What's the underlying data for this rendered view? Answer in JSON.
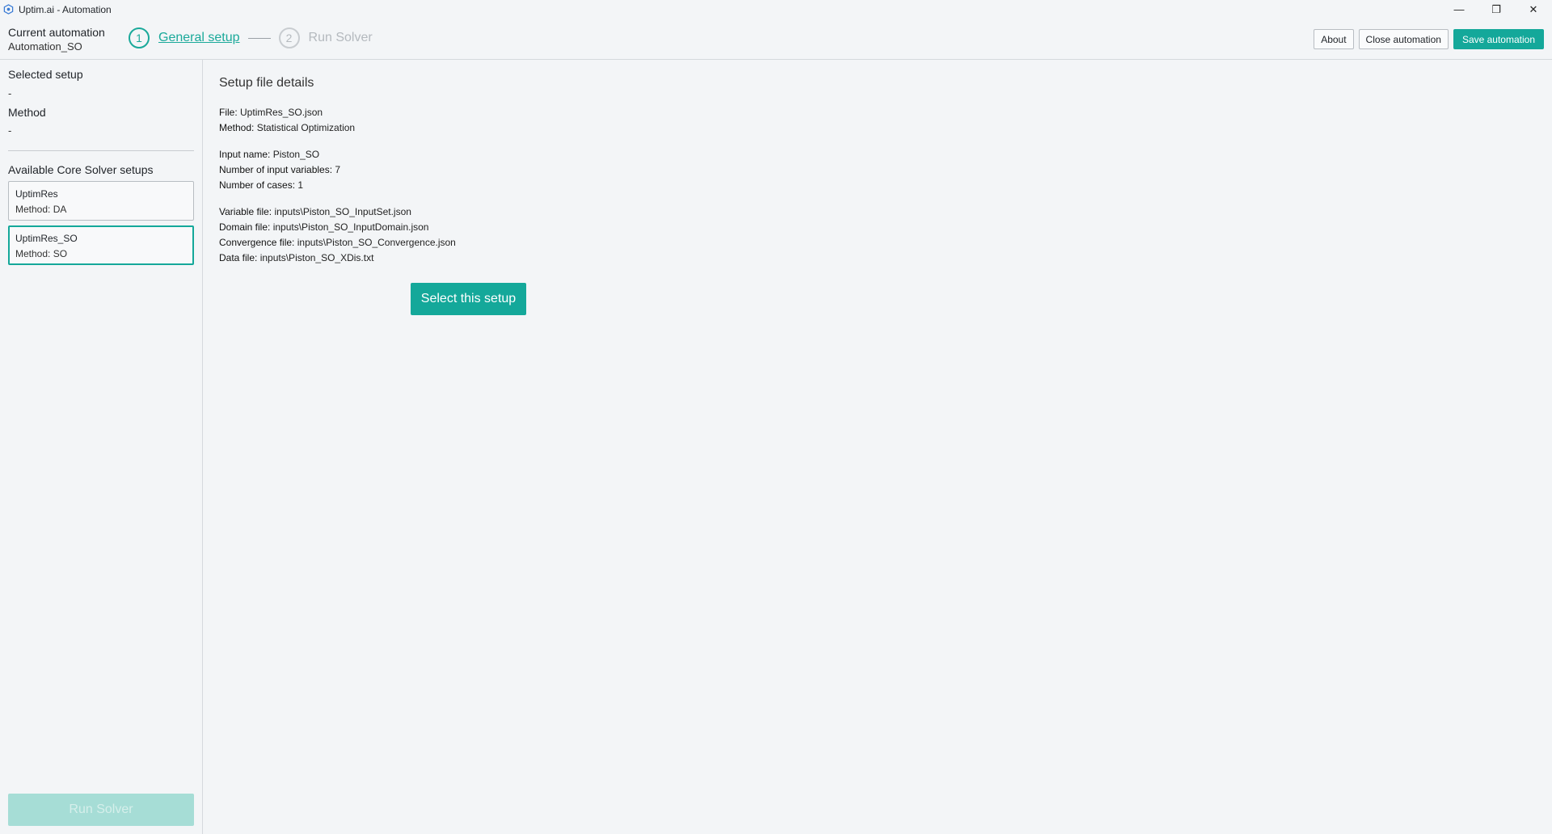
{
  "window": {
    "title": "Uptim.ai - Automation",
    "controls": {
      "minimize": "—",
      "restore": "❐",
      "close": "✕"
    }
  },
  "header": {
    "current_automation_label": "Current automation",
    "current_automation_value": "Automation_SO",
    "steps": [
      {
        "number": "1",
        "label": "General setup",
        "state": "active"
      },
      {
        "number": "2",
        "label": "Run Solver",
        "state": "inactive"
      }
    ],
    "buttons": {
      "about": "About",
      "close": "Close automation",
      "save": "Save automation"
    }
  },
  "sidebar": {
    "selected_setup_label": "Selected setup",
    "selected_setup_value": "-",
    "method_label": "Method",
    "method_value": "-",
    "available_label": "Available Core Solver setups",
    "setups": [
      {
        "name": "UptimRes",
        "method": "Method: DA",
        "selected": false
      },
      {
        "name": "UptimRes_SO",
        "method": "Method: SO",
        "selected": true
      }
    ],
    "run_button": "Run Solver"
  },
  "main": {
    "title": "Setup file details",
    "group1": [
      {
        "key": "File:",
        "value": "UptimRes_SO.json"
      },
      {
        "key": "Method:",
        "value": "Statistical Optimization"
      }
    ],
    "group2": [
      {
        "key": "Input name:",
        "value": "Piston_SO"
      },
      {
        "key": "Number of input variables:",
        "value": "7"
      },
      {
        "key": "Number of cases:",
        "value": "1"
      }
    ],
    "group3": [
      {
        "key": "Variable file:",
        "value": "inputs\\Piston_SO_InputSet.json"
      },
      {
        "key": "Domain file:",
        "value": "inputs\\Piston_SO_InputDomain.json"
      },
      {
        "key": "Convergence file:",
        "value": "inputs\\Piston_SO_Convergence.json"
      },
      {
        "key": "Data file:",
        "value": "inputs\\Piston_SO_XDis.txt"
      }
    ],
    "select_button": "Select this setup"
  },
  "colors": {
    "accent": "#14a89a",
    "accent_disabled": "#a6ddd6",
    "background": "#f3f5f7"
  }
}
